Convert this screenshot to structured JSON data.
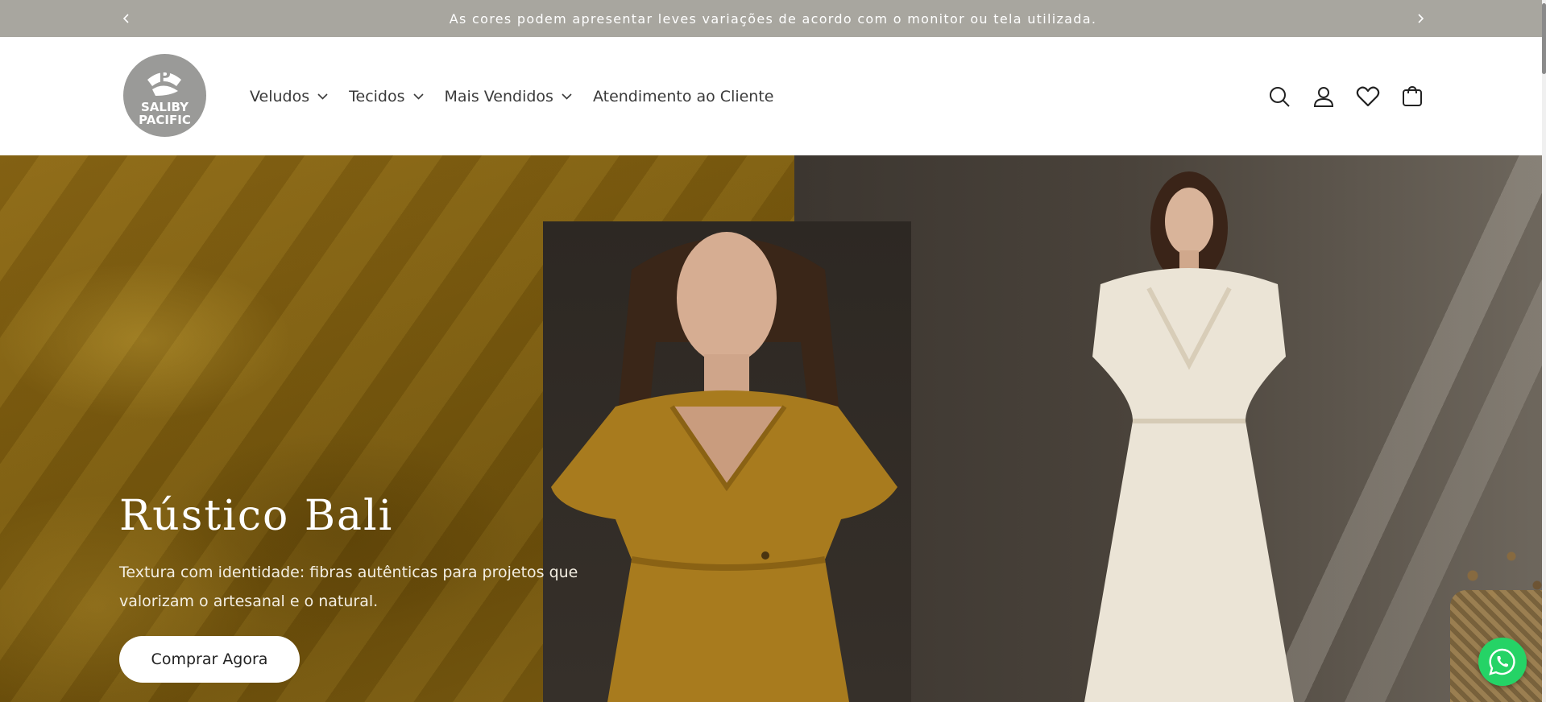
{
  "announcement": {
    "text": "As cores podem apresentar leves variações de acordo com o monitor ou tela utilizada.",
    "prev_icon": "chevron-left-icon",
    "next_icon": "chevron-right-icon"
  },
  "header": {
    "logo": {
      "line1": "SALIBY",
      "line2": "PACIFIC",
      "color": "#9a9a98"
    },
    "nav": [
      {
        "label": "Veludos",
        "has_dropdown": true
      },
      {
        "label": "Tecidos",
        "has_dropdown": true
      },
      {
        "label": "Mais Vendidos",
        "has_dropdown": true
      },
      {
        "label": "Atendimento ao Cliente",
        "has_dropdown": false
      }
    ],
    "icons": [
      "search-icon",
      "account-icon",
      "wishlist-heart-icon",
      "cart-icon"
    ]
  },
  "hero": {
    "title": "Rústico Bali",
    "description": "Textura com identidade: fibras autênticas para projetos que valorizam o artesanal e o natural.",
    "cta_label": "Comprar Agora"
  },
  "colors": {
    "announcement_bg": "#a8a69f",
    "accent_mustard": "#7a5a0e",
    "whatsapp": "#25d366"
  }
}
